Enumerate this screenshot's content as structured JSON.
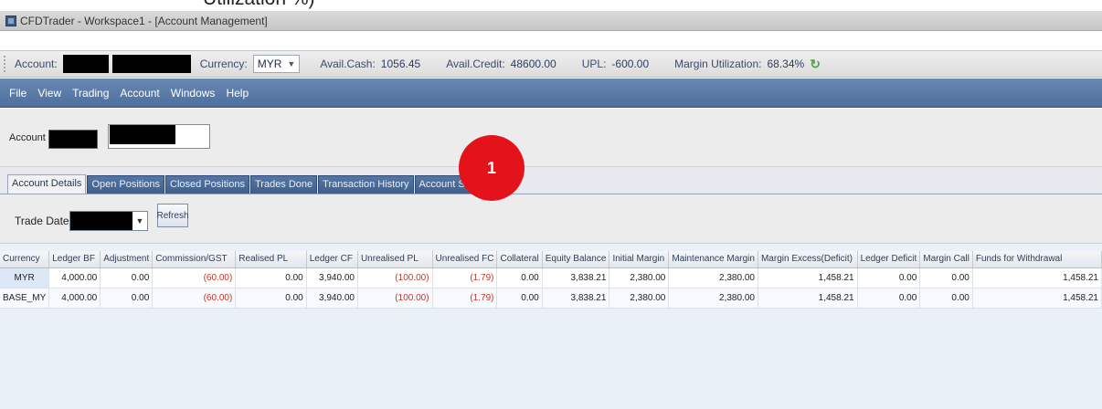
{
  "caption_fragment": "Utilization %)",
  "window": {
    "title": "CFDTrader - Workspace1 - [Account Management]"
  },
  "toolbar": {
    "account_label": "Account:",
    "currency_label": "Currency:",
    "currency_value": "MYR",
    "avail_cash_label": "Avail.Cash:",
    "avail_cash": "1056.45",
    "avail_credit_label": "Avail.Credit:",
    "avail_credit": "48600.00",
    "upl_label": "UPL:",
    "upl": "-600.00",
    "margin_util_label": "Margin Utilization:",
    "margin_util": "68.34%"
  },
  "menu": [
    "File",
    "View",
    "Trading",
    "Account",
    "Windows",
    "Help"
  ],
  "account_row": {
    "label": "Account"
  },
  "tabs": [
    "Account Details",
    "Open Positions",
    "Closed Positions",
    "Trades Done",
    "Transaction History",
    "Account Summary"
  ],
  "filter": {
    "trade_date_label": "Trade Date:",
    "refresh_label": "Refresh"
  },
  "marker": {
    "label": "1"
  },
  "grid": {
    "columns": [
      "Currency",
      "Ledger BF",
      "Adjustment",
      "Commission/GST",
      "Realised PL",
      "Ledger CF",
      "Unrealised PL",
      "Unrealised FC",
      "Collateral",
      "Equity Balance",
      "Initial Margin",
      "Maintenance Margin",
      "Margin Excess(Deficit)",
      "Ledger Deficit",
      "Margin Call",
      "Funds for Withdrawal"
    ],
    "rows": [
      {
        "currency": "MYR",
        "ledger_bf": "4,000.00",
        "adjustment": "0.00",
        "commission": "(60.00)",
        "realised_pl": "0.00",
        "ledger_cf": "3,940.00",
        "unrealised_pl": "(100.00)",
        "unrealised_fc": "(1.79)",
        "collateral": "0.00",
        "equity_balance": "3,838.21",
        "initial_margin": "2,380.00",
        "maintenance_margin": "2,380.00",
        "margin_excess": "1,458.21",
        "ledger_deficit": "0.00",
        "margin_call": "0.00",
        "funds_for_withdrawal": "1,458.21"
      },
      {
        "currency": "BASE_MY",
        "ledger_bf": "4,000.00",
        "adjustment": "0.00",
        "commission": "(60.00)",
        "realised_pl": "0.00",
        "ledger_cf": "3,940.00",
        "unrealised_pl": "(100.00)",
        "unrealised_fc": "(1.79)",
        "collateral": "0.00",
        "equity_balance": "3,838.21",
        "initial_margin": "2,380.00",
        "maintenance_margin": "2,380.00",
        "margin_excess": "1,458.21",
        "ledger_deficit": "0.00",
        "margin_call": "0.00",
        "funds_for_withdrawal": "1,458.21"
      }
    ]
  },
  "colors": {
    "menubar": "#5a7aa7",
    "tab_inactive": "#4b6a96",
    "negative": "#c0392b",
    "marker": "#e4131b"
  }
}
